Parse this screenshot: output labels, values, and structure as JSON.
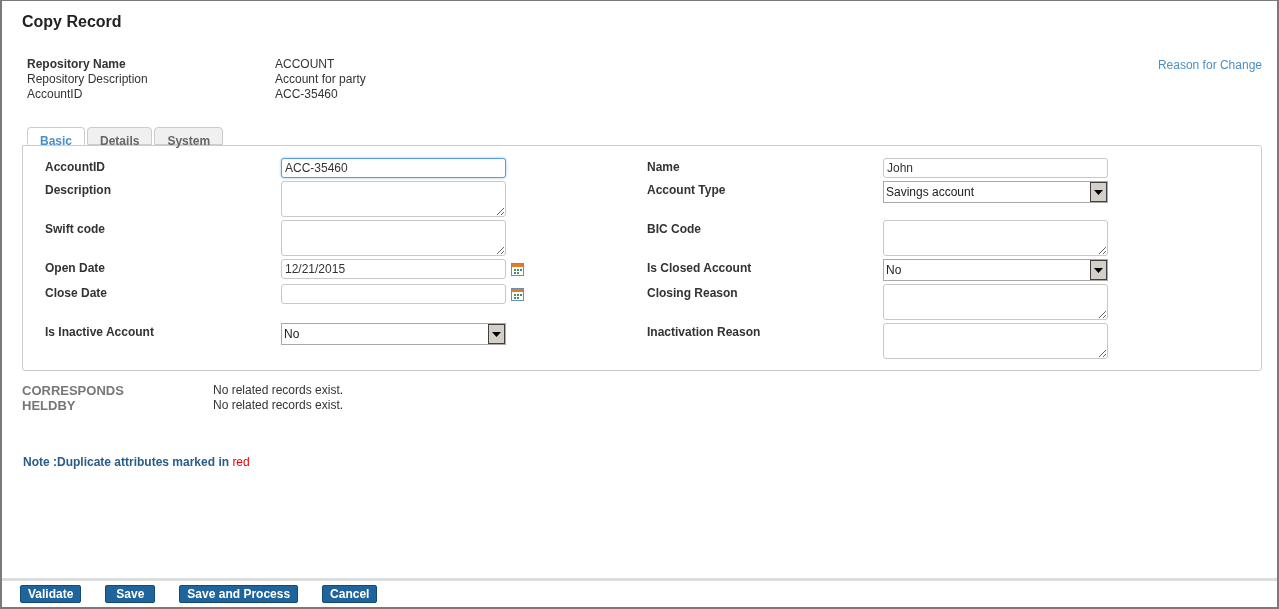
{
  "page_title": "Copy Record",
  "info": [
    {
      "label": "Repository Name",
      "value": "ACCOUNT",
      "bold": true
    },
    {
      "label": "Repository Description",
      "value": "Account for party",
      "bold": false
    },
    {
      "label": "AccountID",
      "value": "ACC-35460",
      "bold": false
    }
  ],
  "reason_link": "Reason for Change",
  "tabs": [
    {
      "label": "Basic",
      "selected": true
    },
    {
      "label": "Details",
      "selected": false
    },
    {
      "label": "System",
      "selected": false
    }
  ],
  "rows": [
    [
      {
        "label": "AccountID",
        "kind": "text",
        "value": "ACC-35460",
        "focused": true
      },
      {
        "label": "Name",
        "kind": "text",
        "value": "John",
        "focused": false
      }
    ],
    [
      {
        "label": "Description",
        "kind": "textarea",
        "focused": false
      },
      {
        "label": "Account Type",
        "kind": "select",
        "value": "Savings account",
        "focused": false
      }
    ],
    [
      {
        "label": "Swift code",
        "kind": "textarea",
        "focused": false
      },
      {
        "label": "BIC Code",
        "kind": "textarea",
        "focused": false
      }
    ],
    [
      {
        "label": "Open Date",
        "kind": "date",
        "value": "12/21/2015",
        "focused": false
      },
      {
        "label": "Is Closed Account",
        "kind": "select",
        "value": "No",
        "focused": false
      }
    ],
    [
      {
        "label": "Close Date",
        "kind": "date",
        "focused": false
      },
      {
        "label": "Closing Reason",
        "kind": "textarea",
        "focused": false
      }
    ],
    [
      {
        "label": "Is Inactive Account",
        "kind": "select",
        "value": "No",
        "focused": false
      },
      {
        "label": "Inactivation Reason",
        "kind": "textarea",
        "focused": false
      }
    ]
  ],
  "relations": [
    {
      "name": "CORRESPONDS",
      "status": "No related records exist."
    },
    {
      "name": "HELDBY",
      "status": "No related records exist."
    }
  ],
  "note": {
    "text": "Note :Duplicate attributes marked in",
    "highlight": "red"
  },
  "buttons": [
    "Validate",
    "Save",
    "Save and Process",
    "Cancel"
  ]
}
